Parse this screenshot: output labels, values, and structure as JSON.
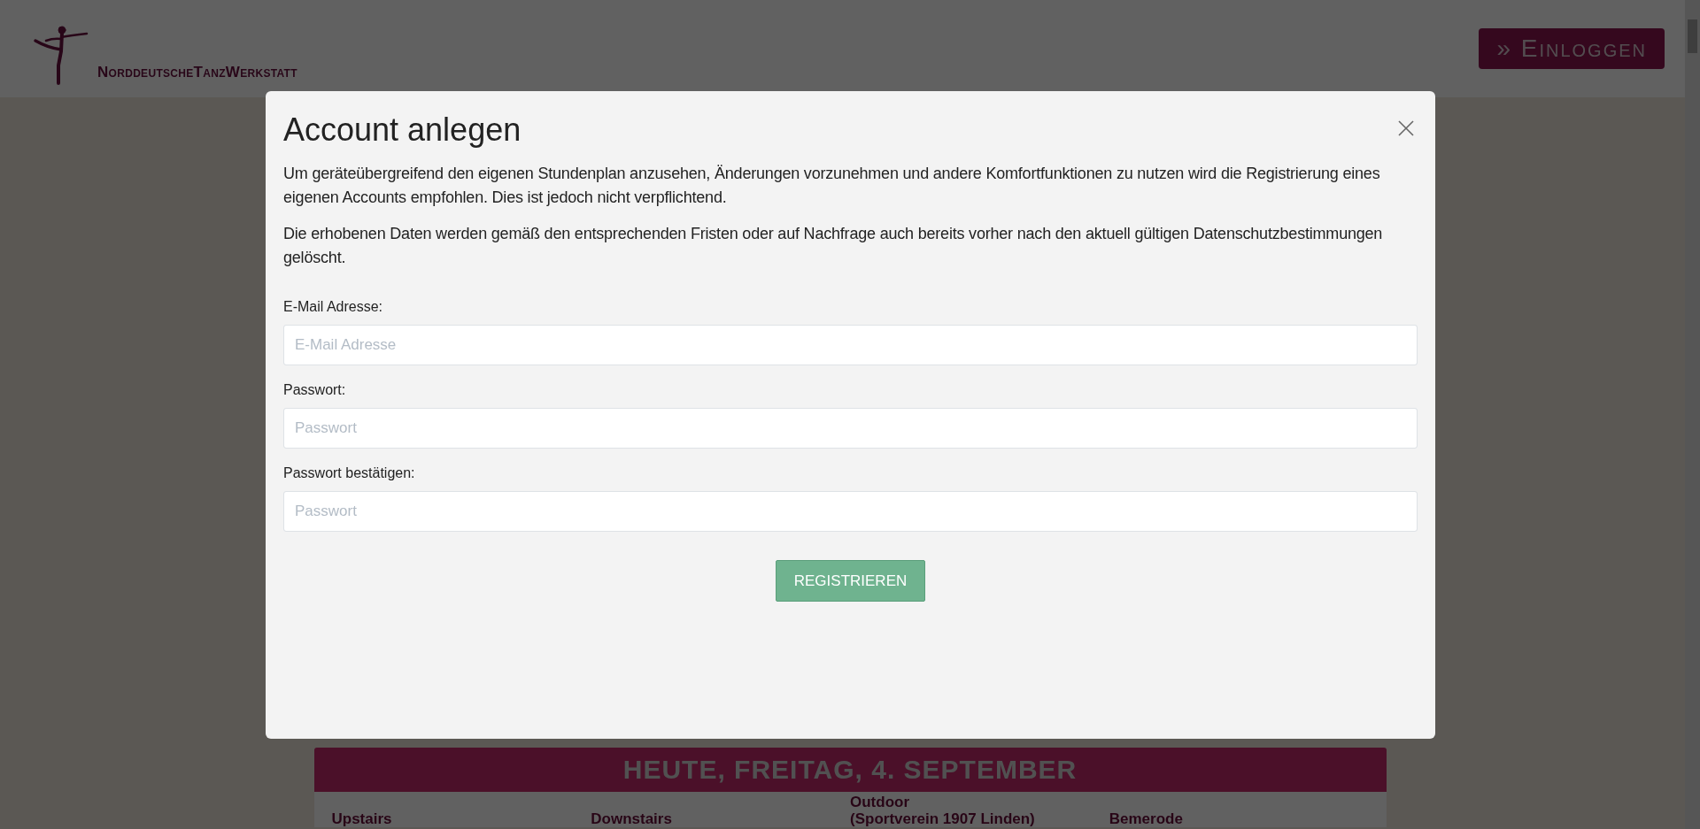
{
  "header": {
    "logo_text": "NorddeutscheTanzWerkstatt",
    "login_button": "» Einloggen"
  },
  "schedule": {
    "date_heading": "HEUTE, FREITAG, 4. SEPTEMBER",
    "columns": [
      {
        "lines": [
          "Upstairs"
        ]
      },
      {
        "lines": [
          "Downstairs"
        ]
      },
      {
        "lines": [
          "Outdoor",
          "(Sportverein 1907 Linden)"
        ]
      },
      {
        "lines": [
          "Bemerode"
        ]
      }
    ]
  },
  "modal": {
    "title": "Account anlegen",
    "paragraphs": [
      "Um geräteübergreifend den eigenen Stundenplan anzusehen, Änderungen vorzunehmen und andere Komfortfunktionen zu nutzen wird die Registrierung eines eigenen Accounts empfohlen. Dies ist jedoch nicht verpflichtend.",
      "Die erhobenen Daten werden gemäß den entsprechenden Fristen oder auf Nachfrage auch bereits vorher nach den aktuell gültigen Datenschutzbestimmungen gelöscht."
    ],
    "fields": [
      {
        "label": "E-Mail Adresse:",
        "placeholder": "E-Mail Adresse"
      },
      {
        "label": "Passwort:",
        "placeholder": "Passwort"
      },
      {
        "label": "Passwort bestätigen:",
        "placeholder": "Passwort"
      }
    ],
    "submit": "REGISTRIEREN"
  }
}
